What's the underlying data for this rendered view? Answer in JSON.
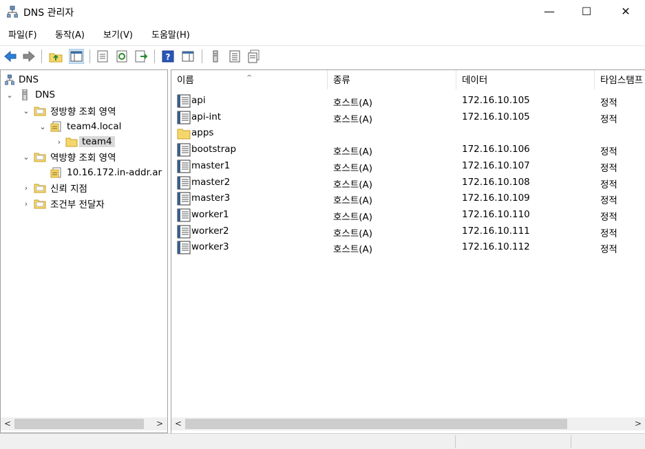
{
  "window": {
    "title": "DNS 관리자",
    "minimize": "—",
    "maximize": "☐",
    "close": "✕"
  },
  "menu": {
    "items": [
      "파일(F)",
      "동작(A)",
      "보기(V)",
      "도움말(H)"
    ]
  },
  "toolbar": {
    "buttons": [
      "back-icon",
      "forward-icon",
      "up-folder-icon",
      "show-hide-tree-icon",
      "properties-icon",
      "refresh-icon",
      "export-icon",
      "help-icon",
      "action-pane-icon",
      "server-icon",
      "list-icon",
      "record-icon"
    ]
  },
  "tree": {
    "root": "DNS",
    "server": "DNS",
    "forward_zone": "정방향 조회 영역",
    "zone": "team4.local",
    "subdomain": "team4",
    "reverse_zone": "역방향 조회 영역",
    "reverse_zone_item": "10.16.172.in-addr.ar",
    "trust_points": "신뢰 지점",
    "conditional_forwarders": "조건부 전달자"
  },
  "list": {
    "columns": [
      "이름",
      "종류",
      "데이터",
      "타임스탬프"
    ],
    "rows": [
      {
        "name": "api",
        "type": "호스트(A)",
        "data": "172.16.10.105",
        "timestamp": "정적",
        "kind": "record"
      },
      {
        "name": "api-int",
        "type": "호스트(A)",
        "data": "172.16.10.105",
        "timestamp": "정적",
        "kind": "record"
      },
      {
        "name": "apps",
        "type": "",
        "data": "",
        "timestamp": "",
        "kind": "folder"
      },
      {
        "name": "bootstrap",
        "type": "호스트(A)",
        "data": "172.16.10.106",
        "timestamp": "정적",
        "kind": "record"
      },
      {
        "name": "master1",
        "type": "호스트(A)",
        "data": "172.16.10.107",
        "timestamp": "정적",
        "kind": "record"
      },
      {
        "name": "master2",
        "type": "호스트(A)",
        "data": "172.16.10.108",
        "timestamp": "정적",
        "kind": "record"
      },
      {
        "name": "master3",
        "type": "호스트(A)",
        "data": "172.16.10.109",
        "timestamp": "정적",
        "kind": "record"
      },
      {
        "name": "worker1",
        "type": "호스트(A)",
        "data": "172.16.10.110",
        "timestamp": "정적",
        "kind": "record"
      },
      {
        "name": "worker2",
        "type": "호스트(A)",
        "data": "172.16.10.111",
        "timestamp": "정적",
        "kind": "record"
      },
      {
        "name": "worker3",
        "type": "호스트(A)",
        "data": "172.16.10.112",
        "timestamp": "정적",
        "kind": "record"
      }
    ]
  },
  "scroll": {
    "left": "<",
    "right": ">"
  },
  "colors": {
    "folder": "#f5d66b",
    "folder_border": "#c9a227",
    "selection": "#d9d9d9",
    "arrow_blue": "#2f7fd6"
  }
}
